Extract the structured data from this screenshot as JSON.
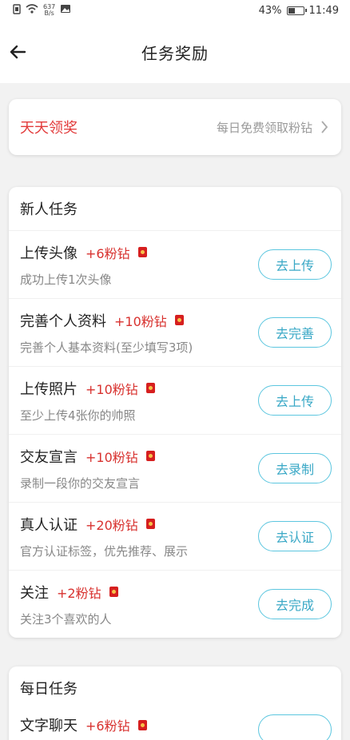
{
  "status": {
    "network_speed_top": "637",
    "network_speed_unit": "B/s",
    "battery_percent": "43%",
    "time": "11:49",
    "battery_level": 0.43
  },
  "nav": {
    "title": "任务奖励"
  },
  "daily_reward": {
    "title": "天天领奖",
    "subtitle": "每日免费领取粉钻"
  },
  "new_tasks": {
    "title": "新人任务",
    "items": [
      {
        "name": "上传头像",
        "reward": "+6粉钻",
        "desc": "成功上传1次头像",
        "button": "去上传"
      },
      {
        "name": "完善个人资料",
        "reward": "+10粉钻",
        "desc": "完善个人基本资料(至少填写3项)",
        "button": "去完善"
      },
      {
        "name": "上传照片",
        "reward": "+10粉钻",
        "desc": "至少上传4张你的帅照",
        "button": "去上传"
      },
      {
        "name": "交友宣言",
        "reward": "+10粉钻",
        "desc": "录制一段你的交友宣言",
        "button": "去录制"
      },
      {
        "name": "真人认证",
        "reward": "+20粉钻",
        "desc": "官方认证标签，优先推荐、展示",
        "button": "去认证"
      },
      {
        "name": "关注",
        "reward": "+2粉钻",
        "desc": "关注3个喜欢的人",
        "button": "去完成"
      }
    ]
  },
  "daily_tasks": {
    "title": "每日任务",
    "items": [
      {
        "name": "文字聊天",
        "reward": "+6粉钻"
      }
    ]
  },
  "colors": {
    "accent_red": "#e23b3b",
    "button_blue": "#5cc6df"
  }
}
